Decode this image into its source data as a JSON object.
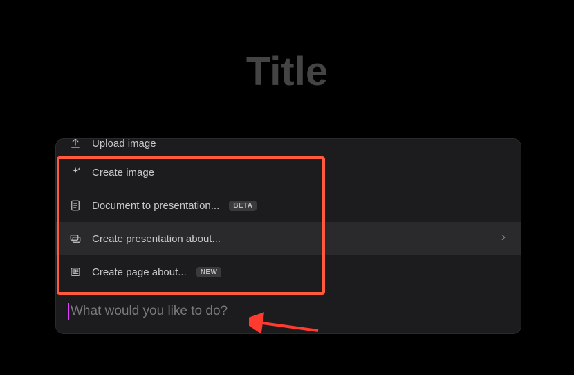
{
  "page": {
    "title": "Title"
  },
  "menu": {
    "items": [
      {
        "label": "Upload image"
      },
      {
        "label": "Create image"
      },
      {
        "label": "Document to presentation...",
        "badge": "BETA"
      },
      {
        "label": "Create presentation about...",
        "highlighted": true,
        "hasChevron": true
      },
      {
        "label": "Create page about...",
        "badge": "NEW"
      }
    ]
  },
  "input": {
    "placeholder": "What would you like to do?"
  },
  "colors": {
    "highlightBorder": "#ff5a3c",
    "annotationArrow": "#ff3b30",
    "caret": "#e040fb"
  }
}
